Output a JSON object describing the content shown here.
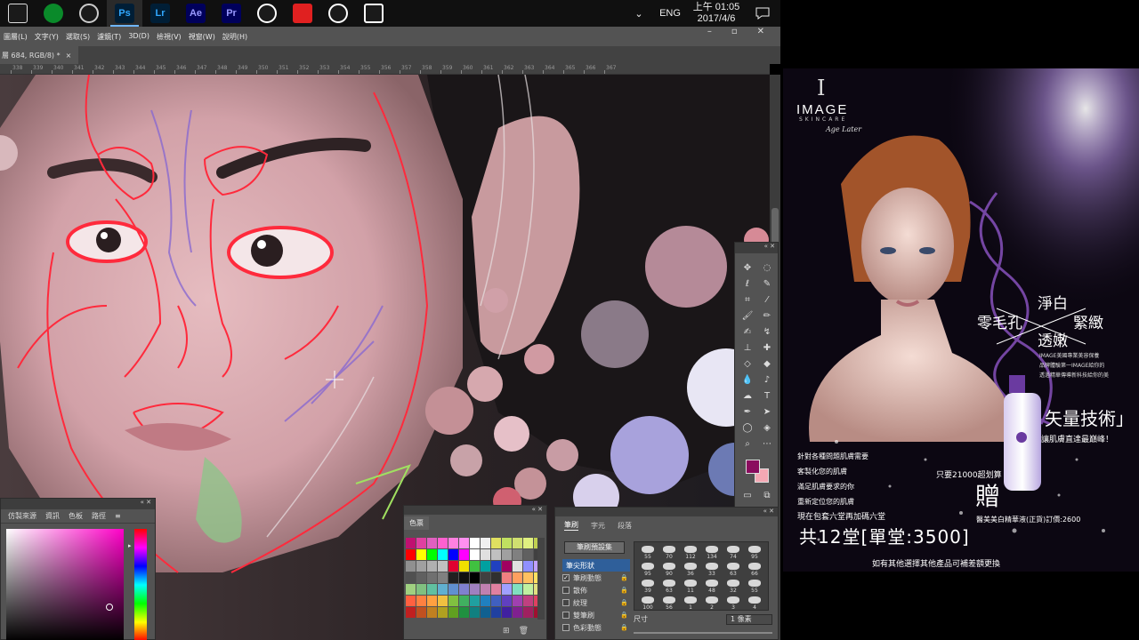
{
  "taskbar": {
    "apps": [
      {
        "name": "app-stack",
        "label": "",
        "bg": "#1a1a1a",
        "fg": "#dddddd"
      },
      {
        "name": "cloud",
        "label": "",
        "bg": "#0a8a2a",
        "fg": "#ffffff"
      },
      {
        "name": "camera",
        "label": "",
        "bg": "#1a1a1a",
        "fg": "#cccccc"
      },
      {
        "name": "photoshop",
        "label": "Ps",
        "bg": "#001e36",
        "fg": "#31a8ff"
      },
      {
        "name": "lightroom",
        "label": "Lr",
        "bg": "#001e36",
        "fg": "#31a8ff"
      },
      {
        "name": "after-effects",
        "label": "Ae",
        "bg": "#00005b",
        "fg": "#9999ff"
      },
      {
        "name": "premiere",
        "label": "Pr",
        "bg": "#00005b",
        "fg": "#9999ff"
      },
      {
        "name": "chrome",
        "label": "",
        "bg": "#1a1a1a",
        "fg": "#ffffff"
      },
      {
        "name": "flash",
        "label": "",
        "bg": "#e02020",
        "fg": "#ffffff"
      },
      {
        "name": "alarm",
        "label": "",
        "bg": "#1a1a1a",
        "fg": "#ffffff"
      },
      {
        "name": "calculator",
        "label": "",
        "bg": "#1a1a1a",
        "fg": "#ffffff"
      }
    ],
    "lang": "ENG",
    "time": "上午 01:05",
    "date": "2017/4/6"
  },
  "menu": [
    "圖層(L)",
    "文字(Y)",
    "選取(S)",
    "濾鏡(T)",
    "3D(D)",
    "檢視(V)",
    "視窗(W)",
    "說明(H)"
  ],
  "document": {
    "tab_label": "層 684, RGB/8) *",
    "ruler_numbers": [
      "338",
      "339",
      "340",
      "341",
      "342",
      "343",
      "344",
      "345",
      "346",
      "347",
      "348",
      "349",
      "350",
      "351",
      "352",
      "353",
      "354",
      "355",
      "356",
      "357",
      "358",
      "359",
      "360",
      "361",
      "362",
      "363",
      "364",
      "365",
      "366",
      "367"
    ]
  },
  "color_panel": {
    "tabs": [
      "仿製來源",
      "資訊",
      "色板",
      "路徑"
    ]
  },
  "swatches_panel": {
    "tab": "色票",
    "colors": [
      "#c01070",
      "#e040a0",
      "#e060c0",
      "#ff60d0",
      "#ff80e0",
      "#ff90f0",
      "#ffffff",
      "#f0f0f0",
      "#e0e060",
      "#c0e060",
      "#d0e070",
      "#e0f080",
      "#c0d050",
      "#ff0000",
      "#ffff00",
      "#00ff00",
      "#00ffff",
      "#0000ff",
      "#ff00ff",
      "#ffffff",
      "#e0e0e0",
      "#c0c0c0",
      "#a0a0a0",
      "#808080",
      "#606060",
      "#404040",
      "#909090",
      "#a0a0a0",
      "#b0b0b0",
      "#c0c0c0",
      "#e00030",
      "#f0e000",
      "#40c040",
      "#00a0a0",
      "#2040c0",
      "#a00060",
      "#e0e0e0",
      "#9090ff",
      "#c0a0ff",
      "#505050",
      "#606060",
      "#707070",
      "#808080",
      "#202020",
      "#101010",
      "#000000",
      "#404040",
      "#303030",
      "#f08080",
      "#ffa060",
      "#ffc060",
      "#ffe060",
      "#a0d080",
      "#80c080",
      "#60c0a0",
      "#60b0d0",
      "#6090d0",
      "#8080d0",
      "#a080c0",
      "#c080b0",
      "#e080a0",
      "#a0a0ff",
      "#80e0c0",
      "#c0f0a0",
      "#e0e080",
      "#ff6040",
      "#ff8040",
      "#ffa040",
      "#f0c040",
      "#80c040",
      "#40b060",
      "#20a0a0",
      "#2080c0",
      "#4060c0",
      "#6040c0",
      "#a040b0",
      "#c04080",
      "#e04060",
      "#c02020",
      "#c05020",
      "#c08020",
      "#b0a020",
      "#60a020",
      "#209040",
      "#108080",
      "#106090",
      "#2040a0",
      "#4020a0",
      "#802090",
      "#a02060",
      "#a01030"
    ]
  },
  "brush_panel": {
    "tabs": [
      "筆刷",
      "字元",
      "段落"
    ],
    "preset_button": "筆刷預設集",
    "options": [
      {
        "label": "筆尖形狀",
        "checked": false,
        "selected": true,
        "lock": false
      },
      {
        "label": "筆刷動態",
        "checked": true,
        "selected": false,
        "lock": true
      },
      {
        "label": "散佈",
        "checked": false,
        "selected": false,
        "lock": true
      },
      {
        "label": "紋理",
        "checked": false,
        "selected": false,
        "lock": true
      },
      {
        "label": "雙筆刷",
        "checked": false,
        "selected": false,
        "lock": true
      },
      {
        "label": "色彩動態",
        "checked": false,
        "selected": false,
        "lock": true
      }
    ],
    "tips": [
      "55",
      "70",
      "112",
      "134",
      "74",
      "95",
      "95",
      "90",
      "36",
      "33",
      "63",
      "66",
      "39",
      "63",
      "11",
      "48",
      "32",
      "55",
      "100",
      "56",
      "1",
      "2",
      "3",
      "4"
    ],
    "size_label": "尺寸",
    "size_value": "1 像素"
  },
  "ad": {
    "brand": "IMAGE",
    "brand_sub": "SKINCARE",
    "tagline": "Age Later",
    "slogan_top": "淨白",
    "slogan_left": "零毛孔",
    "slogan_right": "緊緻",
    "slogan_bottom": "透嫩",
    "small_lines": [
      "IMAGE美國專業美容保養",
      "品牌體驗第一IMAGE給你的",
      "透過精華傳導新科技給你的美"
    ],
    "tech": "矢量技術」",
    "tech_sub": "讓肌膚直達最巔峰！",
    "left_lines": [
      "針對各種問題肌膚需要",
      "客製化您的肌膚",
      "滿足肌膚要求的你",
      "重新定位您的肌膚"
    ],
    "promo_small": "只要21000超划算",
    "gift": "贈",
    "gift_line": "醫美美白精華液(正貨)訂價:2600",
    "offer_line": "現在包套六堂再加碼六堂",
    "big_offer": "共12堂[單堂:3500]",
    "footer": "如有其他選擇其他產品可補差額更換"
  },
  "colors": {
    "accent_red": "#ff2a3c",
    "fg_swatch": "#8a0b5e",
    "bg_swatch": "#f4a8b4"
  }
}
